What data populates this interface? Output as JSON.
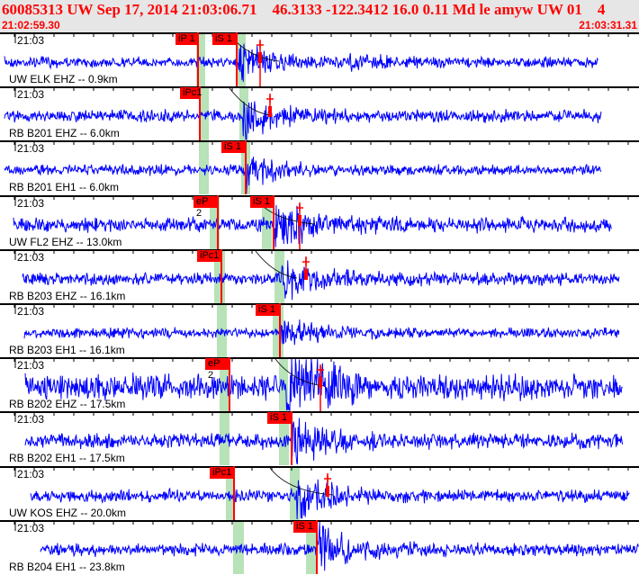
{
  "header": {
    "title": "60085313 UW Sep 17, 2014 21:03:06.71    46.3133 -122.3412 16.0 0.11 Md le amyw UW 01    4",
    "start_time": "21:02:59.30",
    "end_time": "21:03:31.31"
  },
  "colors": {
    "trace": "#0000ff",
    "pick": "#ff0000",
    "window": "#b8e2b8",
    "header_bg": "#e6e6e6"
  },
  "rows": [
    {
      "time_label": "21:03",
      "station": "UW ELK EHZ -- 0.9km",
      "picks": [
        "iP 1",
        "iS 1"
      ]
    },
    {
      "time_label": "21:03",
      "station": "RB B201 EHZ -- 6.0km",
      "picks": [
        "iPc1"
      ]
    },
    {
      "time_label": "21:03",
      "station": "RB B201 EH1 -- 6.0km",
      "picks": [
        "iS 1"
      ]
    },
    {
      "time_label": "21:03",
      "station": "UW FL2 EHZ -- 13.0km",
      "picks": [
        "eP 2",
        "iS 1"
      ]
    },
    {
      "time_label": "21:03",
      "station": "RB B203 EHZ -- 16.1km",
      "picks": [
        "iPc1"
      ]
    },
    {
      "time_label": "21:03",
      "station": "RB B203 EH1 -- 16.1km",
      "picks": [
        "iS 1"
      ]
    },
    {
      "time_label": "21:03",
      "station": "RB B202 EHZ -- 17.5km",
      "picks": [
        "eP 2"
      ]
    },
    {
      "time_label": "21:03",
      "station": "RB B202 EH1 -- 17.5km",
      "picks": [
        "iS 1"
      ]
    },
    {
      "time_label": "21:03",
      "station": "UW KOS EHZ -- 20.0km",
      "picks": [
        "iPc1"
      ]
    },
    {
      "time_label": "21:03",
      "station": "RB B204 EH1 -- 23.8km",
      "picks": [
        "iS 1"
      ]
    }
  ]
}
